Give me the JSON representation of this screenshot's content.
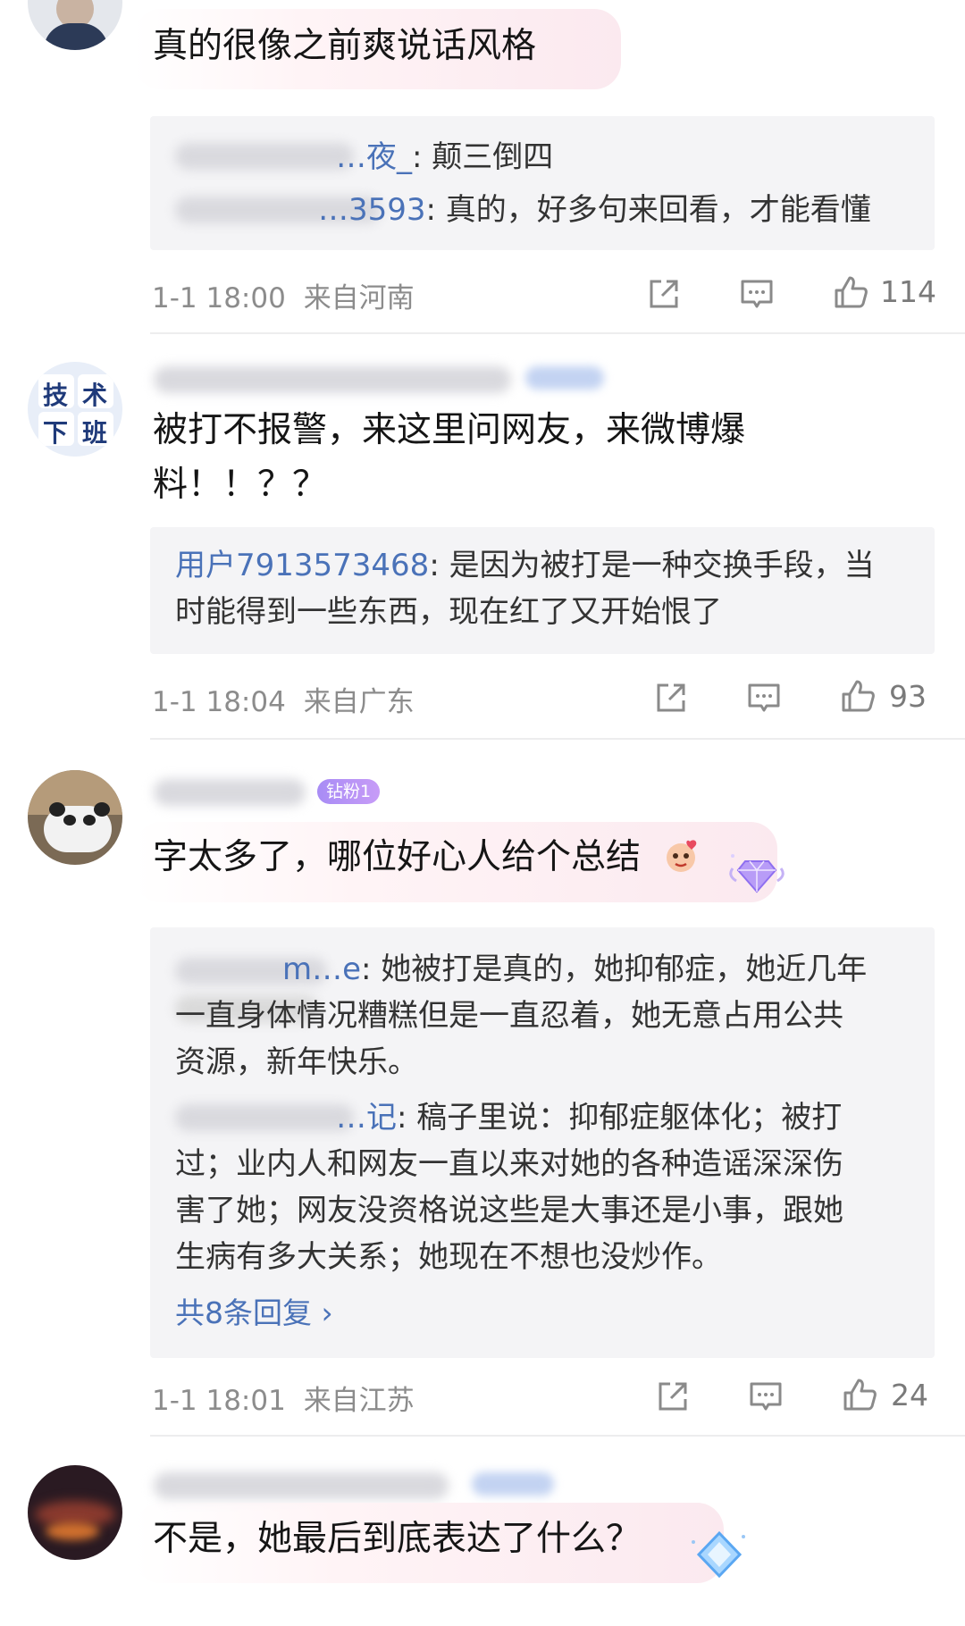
{
  "comments": [
    {
      "text": "真的很像之前爽说话风格",
      "replies": [
        {
          "user": "…夜_",
          "text": ": 颠三倒四"
        },
        {
          "user": "…3593",
          "text": ": 真的，好多句来回看，才能看懂"
        }
      ],
      "time": "1-1 18:00",
      "location": "来自河南",
      "likes": "114"
    },
    {
      "avatar_text": [
        "技",
        "术",
        "下",
        "班"
      ],
      "text_line1": "被打不报警，来这里问网友，来微博爆",
      "text_line2": "料！！？？",
      "replies": [
        {
          "user": "用户7913573468",
          "text": ": 是因为被打是一种交换手段，当",
          "text2": "时能得到一些东西，现在红了又开始恨了"
        }
      ],
      "time": "1-1 18:04",
      "location": "来自广东",
      "likes": "93"
    },
    {
      "badge": "钻粉1",
      "text": "字太多了，哪位好心人给个总结",
      "replies": [
        {
          "user": "m…e",
          "text": ": 她被打是真的，她抑郁症，她近几年",
          "text2": "一直身体情况糟糕但是一直忍着，她无意占用公共",
          "text3": "资源，新年快乐。"
        },
        {
          "user": "…记",
          "text": ": 稿子里说：抑郁症躯体化；被打",
          "text2": "过；业内人和网友一直以来对她的各种造谣深深伤",
          "text3": "害了她；网友没资格说这些是大事还是小事，跟她",
          "text4": "生病有多大关系；她现在不想也没炒作。"
        }
      ],
      "more_replies": "共8条回复 ›",
      "time": "1-1 18:01",
      "location": "来自江苏",
      "likes": "24"
    },
    {
      "text": "不是，她最后到底表达了什么？"
    }
  ],
  "colors": {
    "link": "#4a72b8",
    "meta": "#8c8c8c",
    "reply_bg": "#f4f4f6"
  },
  "icons": [
    "share-icon",
    "comment-icon",
    "like-icon"
  ]
}
